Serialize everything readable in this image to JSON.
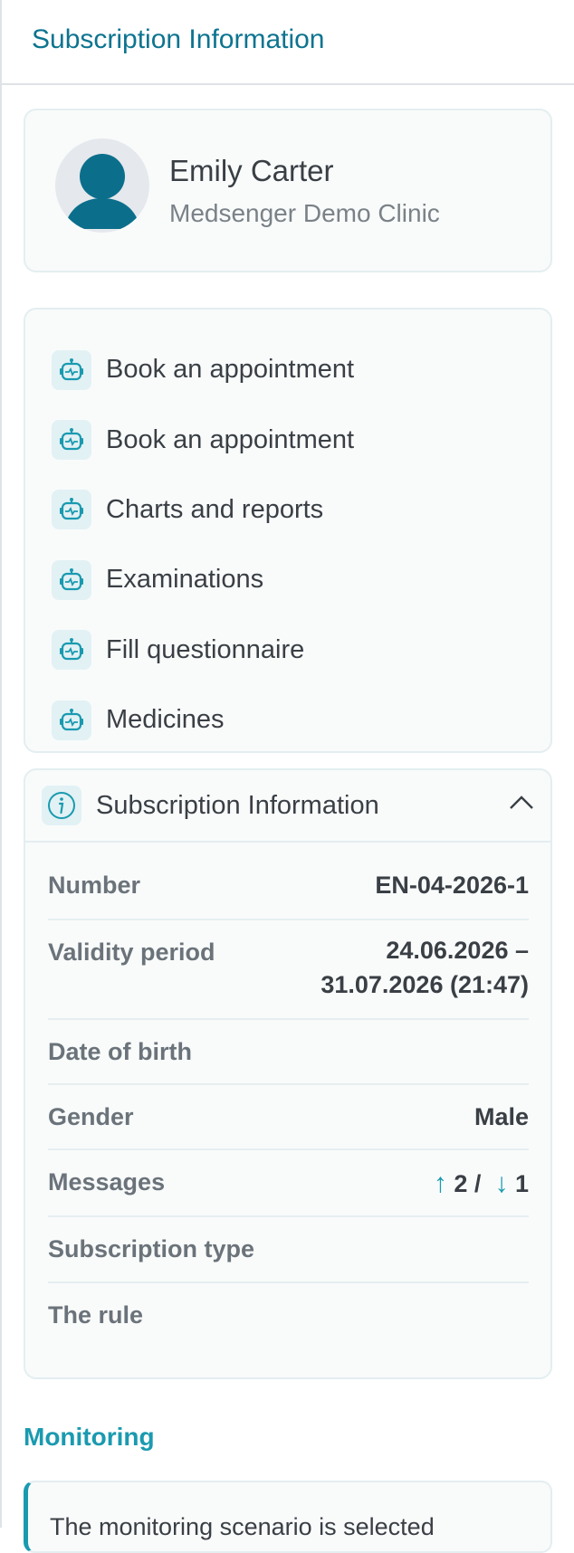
{
  "header": {
    "title": "Subscription Information"
  },
  "profile": {
    "name": "Emily Carter",
    "clinic": "Medsenger Demo Clinic"
  },
  "actions": [
    {
      "label": "Book an appointment",
      "icon": "robot-icon"
    },
    {
      "label": "Book an appointment",
      "icon": "robot-icon"
    },
    {
      "label": "Charts and reports",
      "icon": "robot-icon"
    },
    {
      "label": "Examinations",
      "icon": "robot-icon"
    },
    {
      "label": "Fill questionnaire",
      "icon": "robot-icon"
    },
    {
      "label": "Medicines",
      "icon": "robot-icon"
    }
  ],
  "info": {
    "title": "Subscription Information",
    "expanded": true,
    "rows": {
      "number": {
        "label": "Number",
        "value": "EN-04-2026-1"
      },
      "validity": {
        "label": "Validity period",
        "value_line1": "24.06.2026 –",
        "value_line2": "31.07.2026 (21:47)"
      },
      "dob": {
        "label": "Date of birth",
        "value": ""
      },
      "gender": {
        "label": "Gender",
        "value": "Male"
      },
      "messages": {
        "label": "Messages",
        "sent": "2",
        "received": "1",
        "up_arrow": "↑",
        "down_arrow": "↓",
        "separator": " / "
      },
      "type": {
        "label": "Subscription type",
        "value": ""
      },
      "rule": {
        "label": "The rule",
        "value": ""
      }
    }
  },
  "monitoring": {
    "title": "Monitoring",
    "text": "The monitoring scenario is selected"
  },
  "colors": {
    "accent": "#1a9ab0",
    "header": "#0d7490",
    "avatar": "#0b6f8c"
  }
}
